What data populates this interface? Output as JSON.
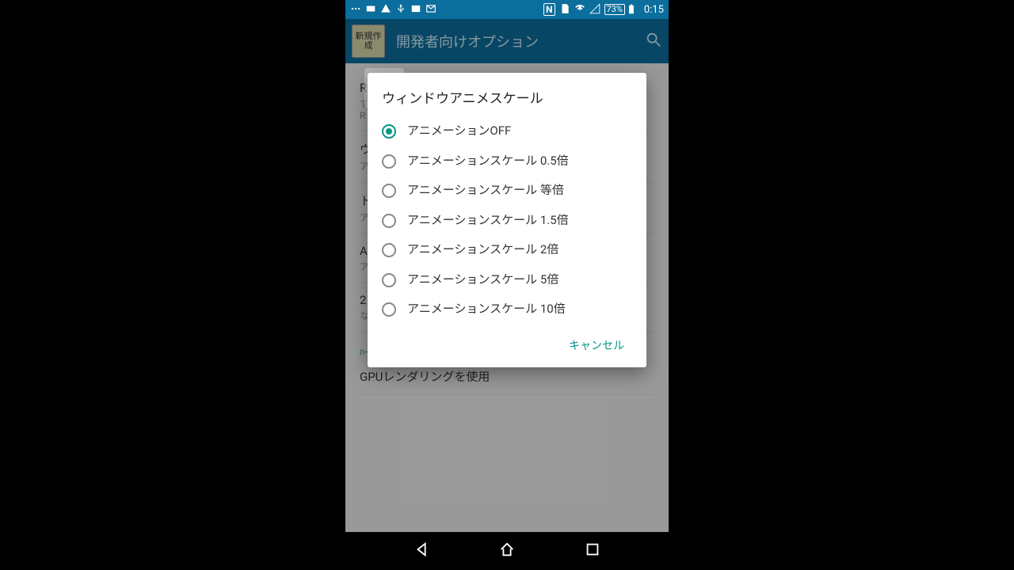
{
  "status": {
    "battery_pct": "73%",
    "time": "0:15"
  },
  "appbar": {
    "new_button": "新規作成",
    "title": "開発者向けオプション"
  },
  "dialog": {
    "title": "ウィンドウアニメスケール",
    "options": [
      {
        "label": "アニメーションOFF",
        "selected": true
      },
      {
        "label": "アニメーションスケール 0.5倍",
        "selected": false
      },
      {
        "label": "アニメーションスケール 等倍",
        "selected": false
      },
      {
        "label": "アニメーションスケール 1.5倍",
        "selected": false
      },
      {
        "label": "アニメーションスケール 2倍",
        "selected": false
      },
      {
        "label": "アニメーションスケール 5倍",
        "selected": false
      },
      {
        "label": "アニメーションスケール 10倍",
        "selected": false
      }
    ],
    "cancel": "キャンセル"
  },
  "background": {
    "items": [
      {
        "title": "R",
        "sub": "す\nR"
      },
      {
        "title": "ウ",
        "sub": "ア"
      },
      {
        "title": "ト",
        "sub": "ア"
      },
      {
        "title": "A",
        "sub": "ア"
      },
      {
        "title": "2",
        "sub": "な"
      }
    ],
    "section": "ﾊｰﾄﾞｳｪｱｱｸｾﾗﾚｰﾃｯﾄﾞ ﾚﾝﾀﾞﾘﾝｸﾞ",
    "gpu": "GPUレンダリングを使用"
  }
}
